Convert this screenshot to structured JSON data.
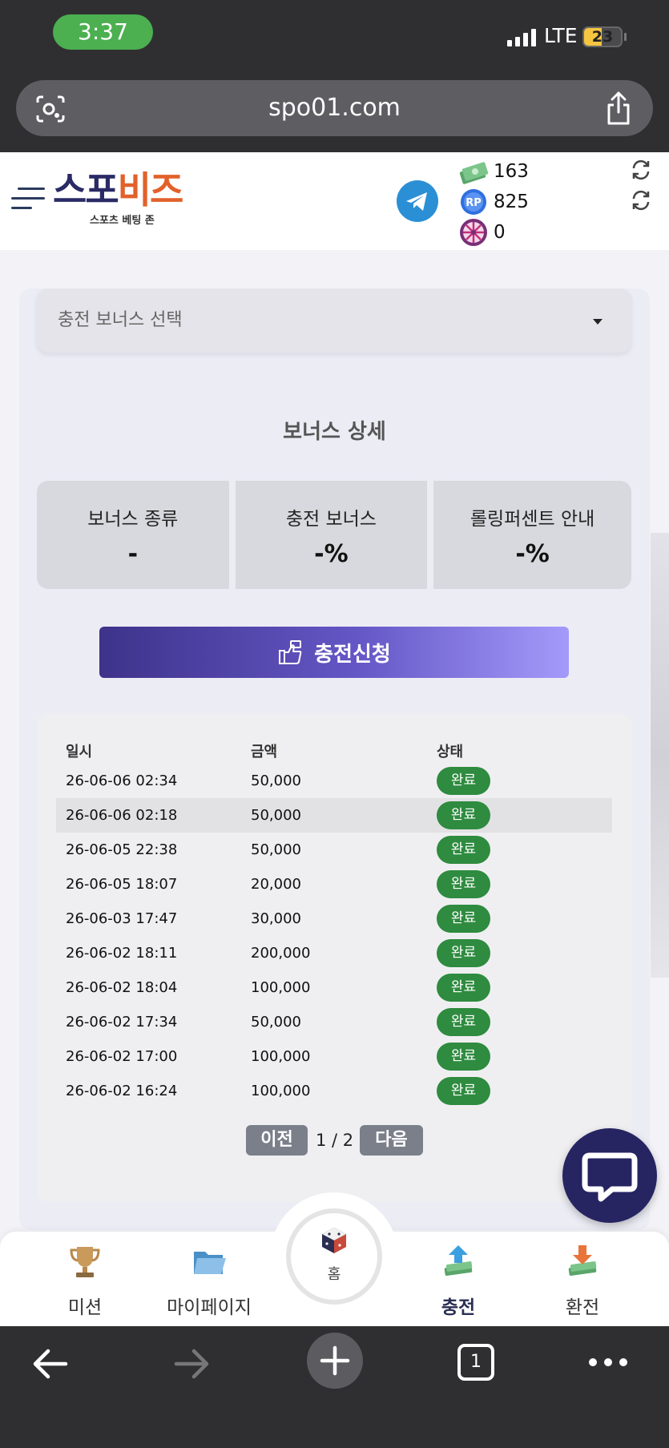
{
  "status_bar": {
    "time": "3:37",
    "network": "LTE",
    "battery": "23"
  },
  "browser": {
    "url": "spo01.com",
    "tab_count": "1"
  },
  "header": {
    "logo_part1": "스포",
    "logo_part2": "비즈",
    "logo_subtitle": "스포츠 베팅 존",
    "balances": [
      {
        "icon": "money-icon",
        "value": "163"
      },
      {
        "icon": "rp-icon",
        "value": "825"
      },
      {
        "icon": "roulette-icon",
        "value": "0"
      }
    ]
  },
  "bonus": {
    "select_placeholder": "충전 보너스 선택",
    "section_title": "보너스 상세",
    "cards": [
      {
        "label": "보너스 종류",
        "value": "-"
      },
      {
        "label": "충전 보너스",
        "value": "-%"
      },
      {
        "label": "롤링퍼센트 안내",
        "value": "-%"
      }
    ],
    "charge_button": "충전신청"
  },
  "history": {
    "columns": [
      "일시",
      "금액",
      "상태"
    ],
    "rows": [
      {
        "date": "26-06-06 02:34",
        "amount": "50,000",
        "status": "완료"
      },
      {
        "date": "26-06-06 02:18",
        "amount": "50,000",
        "status": "완료"
      },
      {
        "date": "26-06-05 22:38",
        "amount": "50,000",
        "status": "완료"
      },
      {
        "date": "26-06-05 18:07",
        "amount": "20,000",
        "status": "완료"
      },
      {
        "date": "26-06-03 17:47",
        "amount": "30,000",
        "status": "완료"
      },
      {
        "date": "26-06-02 18:11",
        "amount": "200,000",
        "status": "완료"
      },
      {
        "date": "26-06-02 18:04",
        "amount": "100,000",
        "status": "완료"
      },
      {
        "date": "26-06-02 17:34",
        "amount": "50,000",
        "status": "완료"
      },
      {
        "date": "26-06-02 17:00",
        "amount": "100,000",
        "status": "완료"
      },
      {
        "date": "26-06-02 16:24",
        "amount": "100,000",
        "status": "완료"
      }
    ],
    "pager": {
      "prev": "이전",
      "page": "1 / 2",
      "next": "다음"
    }
  },
  "bottom_nav": [
    {
      "label": "미션",
      "icon": "trophy-icon"
    },
    {
      "label": "마이페이지",
      "icon": "folder-icon"
    },
    {
      "label": "홈",
      "icon": "home-icon"
    },
    {
      "label": "충전",
      "icon": "deposit-icon",
      "active": true
    },
    {
      "label": "환전",
      "icon": "withdraw-icon"
    }
  ]
}
